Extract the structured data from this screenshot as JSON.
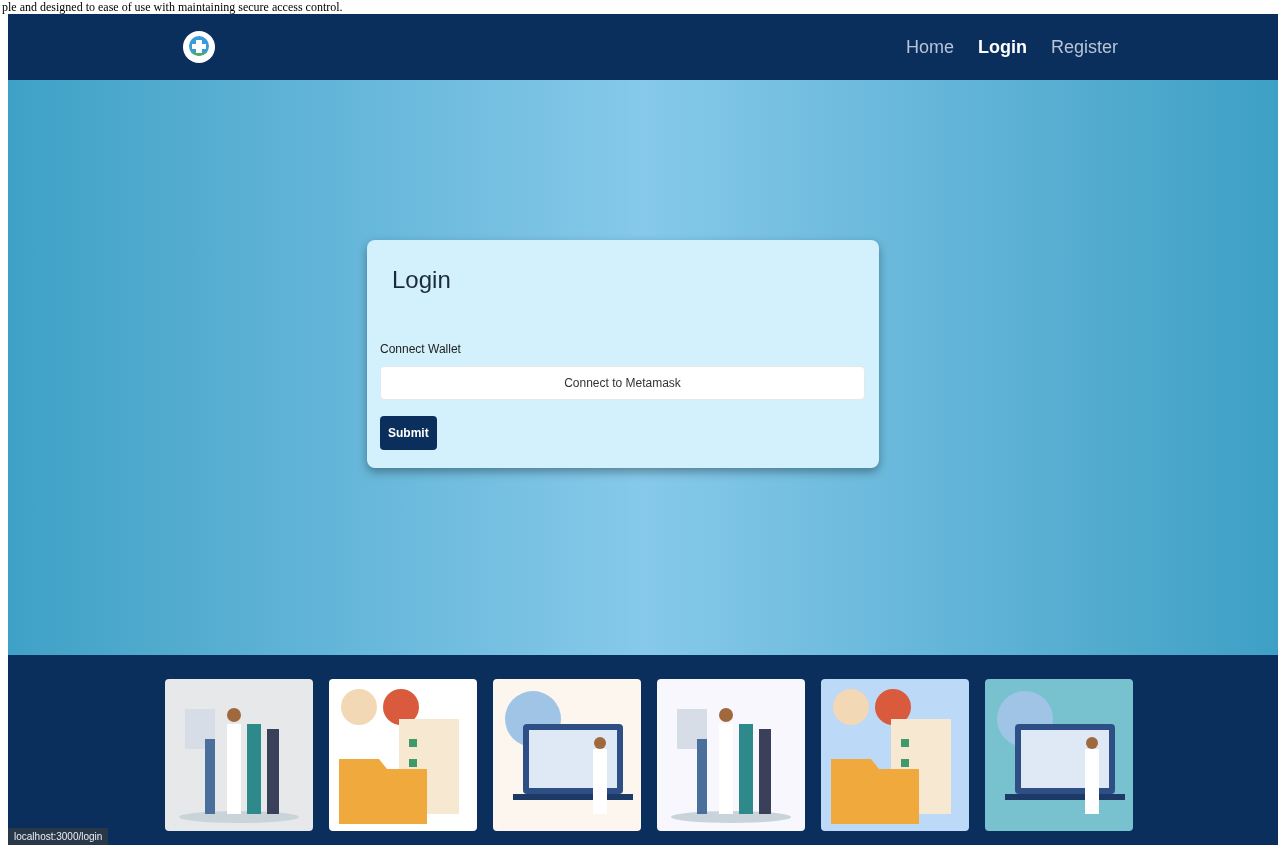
{
  "caption": "ple and designed to ease of use with maintaining secure access control.",
  "nav": {
    "items": [
      {
        "label": "Home",
        "selected": false
      },
      {
        "label": "Login",
        "selected": true
      },
      {
        "label": "Register",
        "selected": false
      }
    ]
  },
  "login": {
    "title": "Login",
    "field_label": "Connect Wallet",
    "connect_button": "Connect to Metamask",
    "submit_button": "Submit"
  },
  "status_bar": "localhost:3000/login"
}
